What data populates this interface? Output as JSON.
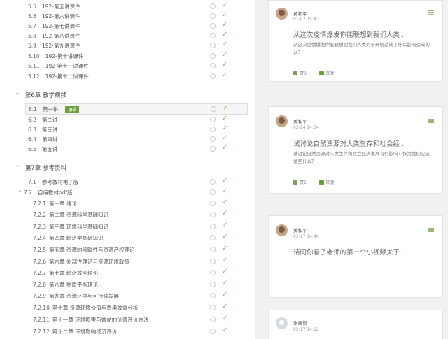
{
  "outline": {
    "pre_items": [
      {
        "num": "5.5",
        "title": "192-第五讲课件"
      },
      {
        "num": "5.6",
        "title": "192-第六讲课件"
      },
      {
        "num": "5.7",
        "title": "192-第七讲课件"
      },
      {
        "num": "5.8",
        "title": "192-第八讲课件"
      },
      {
        "num": "5.9",
        "title": "192-第九讲课件"
      },
      {
        "num": "5.10",
        "title": "192-第十讲课件"
      },
      {
        "num": "5.11",
        "title": "192-第十一讲课件"
      },
      {
        "num": "5.12",
        "title": "192-第十二讲课件"
      }
    ],
    "chapter6": {
      "label": "第6章 教学视频"
    },
    "ch6_items": [
      {
        "num": "6.1",
        "title": "第一讲",
        "badge": "编辑"
      },
      {
        "num": "6.2",
        "title": "第二讲"
      },
      {
        "num": "6.3",
        "title": "第三讲"
      },
      {
        "num": "6.4",
        "title": "第四讲"
      },
      {
        "num": "6.5",
        "title": "第五讲"
      }
    ],
    "chapter7": {
      "label": "第7章 参考资料"
    },
    "ch7_items": [
      {
        "num": "7.1",
        "title": "参考教材电子版"
      },
      {
        "num": "7.2",
        "title": "自编教材pdf版"
      },
      {
        "num": "7.2.1",
        "title": "第一章 绪论"
      },
      {
        "num": "7.2.2",
        "title": "第二章 资源科学基础知识"
      },
      {
        "num": "7.2.3",
        "title": "第三章 环境科学基础知识"
      },
      {
        "num": "7.2.4",
        "title": "第四章 经济学基础知识"
      },
      {
        "num": "7.2.5",
        "title": "第五章 资源的稀缺性与资源产权理论"
      },
      {
        "num": "7.2.6",
        "title": "第六章 外部性理论与资源环境政策"
      },
      {
        "num": "7.2.7",
        "title": "第七章 经济效率理论"
      },
      {
        "num": "7.2.8",
        "title": "第八章 物质平衡理论"
      },
      {
        "num": "7.2.9",
        "title": "第九章 资源环境与可持续发展"
      },
      {
        "num": "7.2.10",
        "title": "第十章 资源环境价值与费用效益分析"
      },
      {
        "num": "7.2.11",
        "title": "第十一章 环境损害与效益的价值评价方法"
      },
      {
        "num": "7.2.12",
        "title": "第十二章 环境影响经济评价"
      }
    ]
  },
  "discussions": [
    {
      "user": "黄和平",
      "date": "01-02 15:43",
      "title": "从这次疫情爆发你能联想到我们人类 ...",
      "body": "从这次疫情爆发你能联想到我们人类对于环境造成了什么影响造成的么？",
      "likes": "赞0",
      "reply": "回复"
    },
    {
      "user": "黄和平",
      "date": "02-24 14:34",
      "title": "试讨论自然资源对人类生存和社会经 ...",
      "body": "试讨论自然资源对人类生存和社会经济发展有何影响？作为我们应该做些什么？",
      "likes": "赞1",
      "reply": "回复"
    },
    {
      "user": "黄和平",
      "date": "02-17 14:46",
      "title": "请问你看了老师的第一个小视频关于 ..."
    },
    {
      "user": "张启恒",
      "date": "02-17 14:12"
    }
  ]
}
